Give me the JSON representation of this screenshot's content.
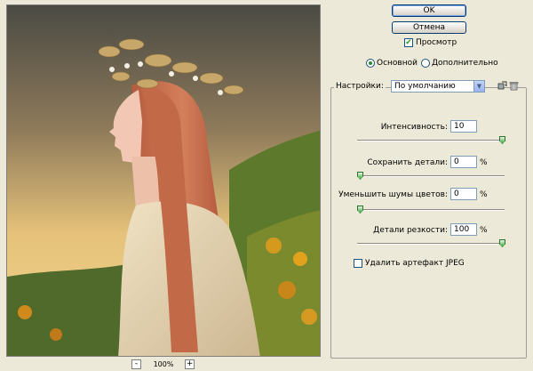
{
  "buttons": {
    "ok": "OK",
    "cancel": "Отмена"
  },
  "preview": {
    "label": "Просмотр",
    "checked": true
  },
  "mode": {
    "basic": "Основной",
    "advanced": "Дополнительно",
    "selected": "basic"
  },
  "settings": {
    "label": "Настройки:",
    "value": "По умолчанию"
  },
  "params": {
    "strength": {
      "label": "Интенсивность:",
      "value": "10",
      "fraction": 1.0
    },
    "preserve": {
      "label": "Сохранить детали:",
      "value": "0",
      "unit": "%",
      "fraction": 0.0
    },
    "reduce_color": {
      "label": "Уменьшить шумы цветов:",
      "value": "0",
      "unit": "%",
      "fraction": 0.0
    },
    "sharpen": {
      "label": "Детали резкости:",
      "value": "100",
      "unit": "%",
      "fraction": 1.0
    }
  },
  "jpeg_artifact": {
    "label": "Удалить артефакт JPEG",
    "checked": false
  },
  "zoom": {
    "minus": "-",
    "value": "100%",
    "plus": "+"
  },
  "icons": {
    "save_settings": "save-preset-icon",
    "delete_settings": "trash-icon"
  }
}
